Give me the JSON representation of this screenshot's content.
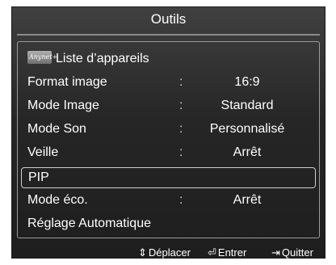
{
  "title": "Outils",
  "menu": {
    "anynet_badge": "Anynet+",
    "items": [
      {
        "label": "Liste d’appareils",
        "value": ""
      },
      {
        "label": "Format image",
        "value": "16:9"
      },
      {
        "label": "Mode Image",
        "value": "Standard"
      },
      {
        "label": "Mode Son",
        "value": "Personnalisé"
      },
      {
        "label": "Veille",
        "value": "Arrêt"
      },
      {
        "label": "PIP",
        "value": ""
      },
      {
        "label": "Mode éco.",
        "value": "Arrêt"
      },
      {
        "label": "Réglage Automatique",
        "value": ""
      }
    ],
    "separator": ":",
    "selected_index": 5
  },
  "footer": {
    "move": {
      "icon": "up-down-arrow-icon",
      "label": "Déplacer"
    },
    "enter": {
      "icon": "enter-icon",
      "label": "Entrer"
    },
    "quit": {
      "icon": "exit-icon",
      "label": "Quitter"
    }
  }
}
